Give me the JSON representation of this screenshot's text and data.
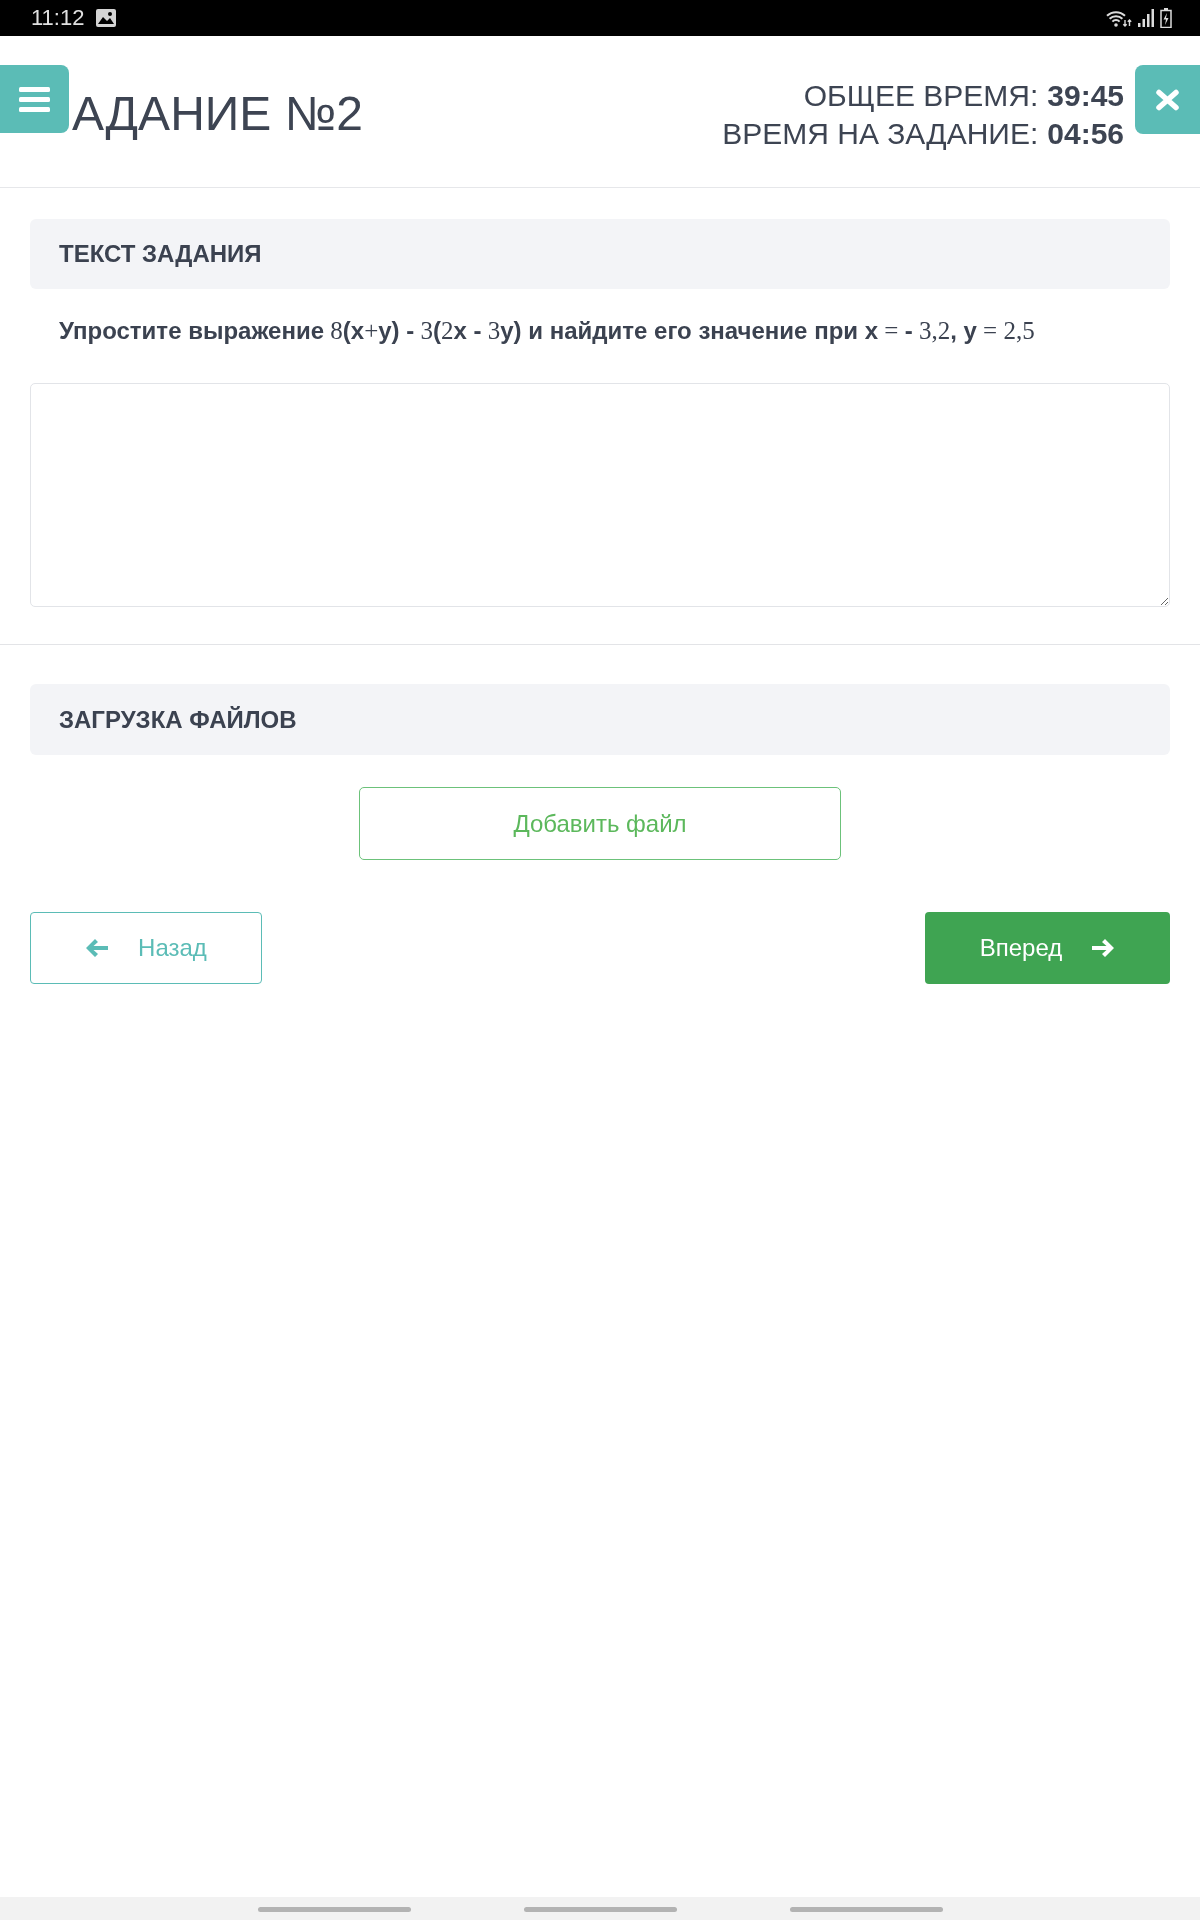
{
  "status_bar": {
    "time": "11:12"
  },
  "header": {
    "title": "АДАНИЕ №2",
    "timers": [
      {
        "label": "ОБЩЕЕ ВРЕМЯ:",
        "value": "39:45"
      },
      {
        "label": "ВРЕМЯ НА ЗАДАНИЕ:",
        "value": "04:56"
      }
    ]
  },
  "task": {
    "heading": "ТЕКСТ ЗАДАНИЯ",
    "text": "**Упростите выражение** 8**(x**+**y) -** 3**(**2**x -** 3**y) и найдите его значение при x** = **-** 3,2**, y** = 2,5"
  },
  "upload": {
    "heading": "ЗАГРУЗКА ФАЙЛОВ",
    "button": "Добавить файл"
  },
  "navigation": {
    "back": "Назад",
    "forward": "Вперед"
  }
}
